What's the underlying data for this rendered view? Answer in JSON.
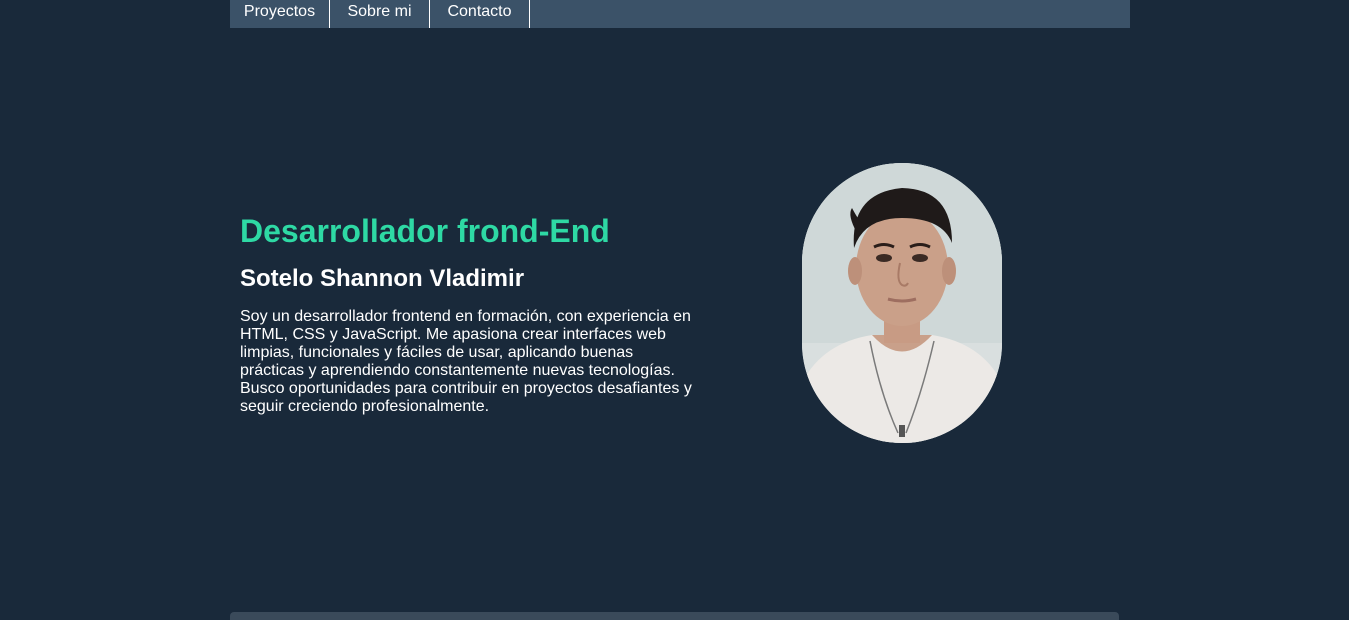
{
  "nav": {
    "items": [
      {
        "label": "Proyectos"
      },
      {
        "label": "Sobre mi"
      },
      {
        "label": "Contacto"
      }
    ]
  },
  "hero": {
    "title": "Desarrollador frond-End",
    "name": "Sotelo Shannon Vladimir",
    "bio": "Soy un desarrollador frontend en formación, con experiencia en HTML, CSS y JavaScript. Me apasiona crear interfaces web limpias, funcionales y fáciles de usar, aplicando buenas prácticas y aprendiendo constantemente nuevas tecnologías. Busco oportunidades para contribuir en proyectos desafiantes y seguir creciendo profesionalmente."
  },
  "colors": {
    "background": "#19293a",
    "nav_background": "#3b5268",
    "accent": "#2ed9a4",
    "text": "#ffffff"
  }
}
